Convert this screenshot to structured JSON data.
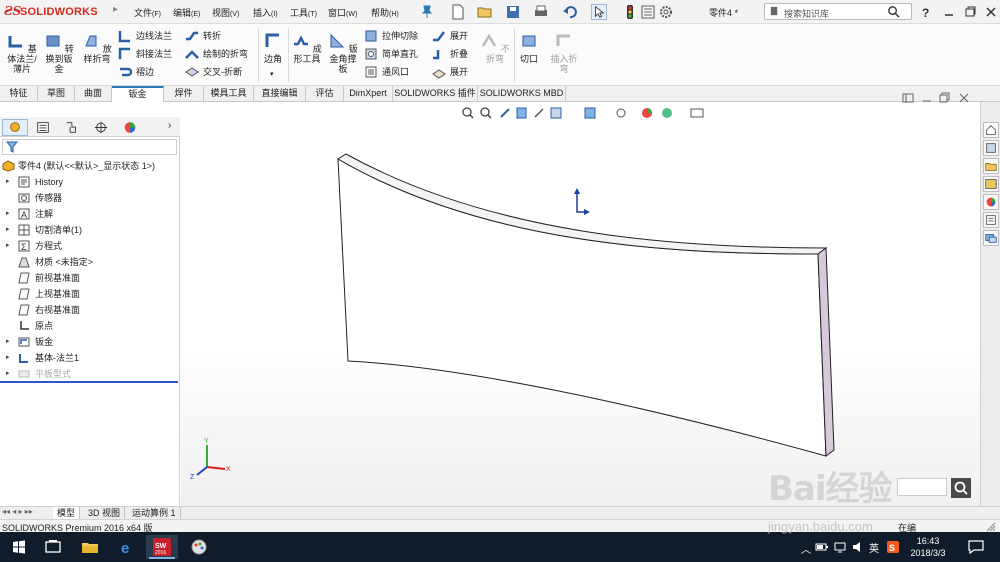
{
  "app": {
    "brand": "SOLIDWORKS",
    "part_name": "零件4 *",
    "colors": {
      "brand_red": "#d52b1e",
      "accent_blue": "#2a7ab8",
      "taskbar": "#101c2b"
    }
  },
  "menu": [
    {
      "label": "文件",
      "key": "(F)"
    },
    {
      "label": "编辑",
      "key": "(E)"
    },
    {
      "label": "视图",
      "key": "(V)"
    },
    {
      "label": "插入",
      "key": "(I)"
    },
    {
      "label": "工具",
      "key": "(T)"
    },
    {
      "label": "窗口",
      "key": "(W)"
    },
    {
      "label": "帮助",
      "key": "(H)"
    }
  ],
  "search": {
    "placeholder": "搜索知识库"
  },
  "ribbon": {
    "big": [
      {
        "label": "基体法兰/薄片",
        "icon": "base-flange-icon"
      },
      {
        "label": "转换到钣金",
        "icon": "convert-to-sheetmetal-icon"
      },
      {
        "label": "放样折弯",
        "icon": "lofted-bend-icon"
      },
      {
        "label": "边角",
        "icon": "corners-icon"
      },
      {
        "label": "成形工具",
        "icon": "forming-tool-icon"
      },
      {
        "label": "钣金角撑板",
        "icon": "sheetmetal-gusset-icon"
      },
      {
        "label": "不折弯",
        "icon": "no-bends-icon"
      },
      {
        "label": "切口",
        "icon": "rip-icon"
      },
      {
        "label": "插入折弯",
        "icon": "insert-bends-icon"
      }
    ],
    "small": [
      {
        "label": "边线法兰",
        "icon": "edge-flange-icon"
      },
      {
        "label": "斜接法兰",
        "icon": "miter-flange-icon"
      },
      {
        "label": "褶边",
        "icon": "hem-icon"
      },
      {
        "label": "转折",
        "icon": "jog-icon"
      },
      {
        "label": "绘制的折弯",
        "icon": "sketched-bend-icon"
      },
      {
        "label": "交叉-折断",
        "icon": "cross-break-icon"
      },
      {
        "label": "拉伸切除",
        "icon": "extruded-cut-icon"
      },
      {
        "label": "简单直孔",
        "icon": "simple-hole-icon"
      },
      {
        "label": "通风口",
        "icon": "vent-icon"
      },
      {
        "label": "展开",
        "icon": "unfold-icon"
      },
      {
        "label": "折叠",
        "icon": "fold-icon"
      },
      {
        "label": "展开",
        "icon": "flatten-icon"
      }
    ]
  },
  "tabs": [
    "特征",
    "草图",
    "曲面",
    "钣金",
    "焊件",
    "模具工具",
    "直接编辑",
    "评估",
    "DimXpert",
    "SOLIDWORKS 插件",
    "SOLIDWORKS MBD"
  ],
  "active_tab": "钣金",
  "tree": {
    "root": "零件4 (默认<<默认>_显示状态 1>)",
    "items": [
      {
        "label": "History",
        "expandable": true
      },
      {
        "label": "传感器",
        "expandable": false
      },
      {
        "label": "注解",
        "expandable": true
      },
      {
        "label": "切割清单(1)",
        "expandable": true
      },
      {
        "label": "方程式",
        "expandable": true
      },
      {
        "label": "材质 <未指定>",
        "expandable": false
      },
      {
        "label": "前视基准面",
        "expandable": false
      },
      {
        "label": "上视基准面",
        "expandable": false
      },
      {
        "label": "右视基准面",
        "expandable": false
      },
      {
        "label": "原点",
        "expandable": false
      },
      {
        "label": "钣金",
        "expandable": true
      },
      {
        "label": "基体-法兰1",
        "expandable": true
      },
      {
        "label": "平板型式",
        "expandable": true,
        "greyed": true
      }
    ]
  },
  "model_tabs": [
    "模型",
    "3D 视图",
    "运动算例 1"
  ],
  "active_model_tab": "模型",
  "status": {
    "text": "SOLIDWORKS Premium 2016 x64 版",
    "right": "在编"
  },
  "triad": {
    "x": "X",
    "y": "Y",
    "z": "Z"
  },
  "taskbar": {
    "time": "16:43",
    "date": "2018/3/3",
    "ime": "英",
    "sw_badge": "2016"
  },
  "watermark": {
    "text": "Bai经验",
    "url": "jingyan.baidu.com"
  }
}
